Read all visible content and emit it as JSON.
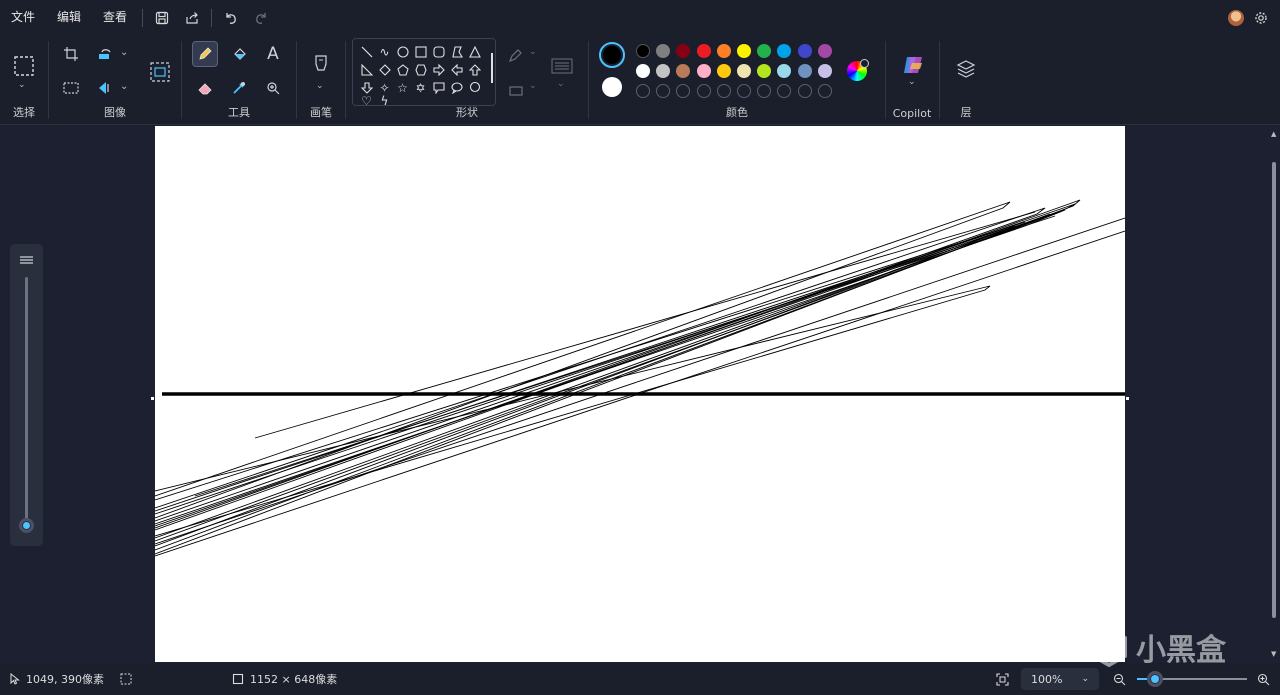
{
  "menu": {
    "file": "文件",
    "edit": "编辑",
    "view": "查看"
  },
  "ribbon": {
    "select_label": "选择",
    "image_label": "图像",
    "tools_label": "工具",
    "brush_label": "画笔",
    "shapes_label": "形状",
    "colors_label": "颜色",
    "copilot_label": "Copilot",
    "layers_label": "层"
  },
  "colors": {
    "primary": "#000000",
    "secondary": "#ffffff",
    "palette_row1": [
      "#000000",
      "#7f7f7f",
      "#880015",
      "#ed1c24",
      "#ff7f27",
      "#fff200",
      "#22b14c",
      "#00a2e8",
      "#3f48cc",
      "#a349a4"
    ],
    "palette_row2": [
      "#ffffff",
      "#c3c3c3",
      "#b97a57",
      "#ffaec9",
      "#ffc90e",
      "#efe4b0",
      "#b5e61d",
      "#99d9ea",
      "#7092be",
      "#c8bfe7"
    ],
    "accent": "#4cc2ff"
  },
  "status": {
    "cursor_pos": "1049, 390像素",
    "canvas_size": "1152 × 648像素",
    "zoom": "100%"
  },
  "watermark": "小黑盒"
}
